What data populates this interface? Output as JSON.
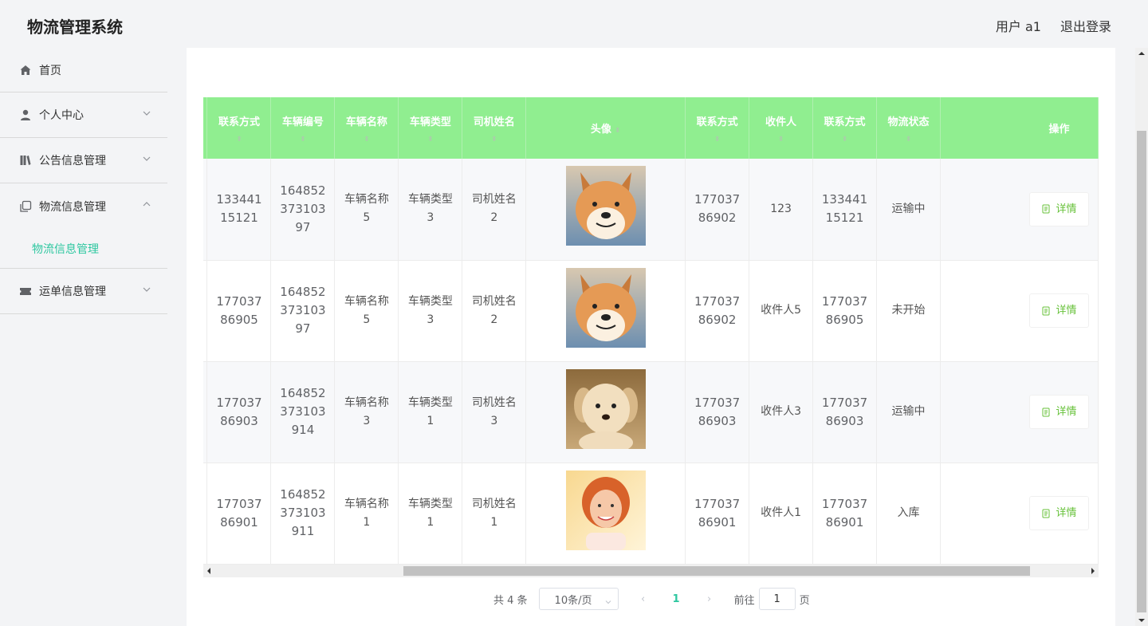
{
  "app_title": "物流管理系统",
  "header": {
    "user_label": "用户 a1",
    "logout_label": "退出登录"
  },
  "sidebar": {
    "items": [
      {
        "label": "首页",
        "icon": "home-icon"
      },
      {
        "label": "个人中心",
        "icon": "user-icon"
      },
      {
        "label": "公告信息管理",
        "icon": "notice-icon"
      },
      {
        "label": "物流信息管理",
        "icon": "copy-icon",
        "sub": "物流信息管理"
      },
      {
        "label": "运单信息管理",
        "icon": "ticket-icon"
      }
    ]
  },
  "table": {
    "columns": [
      "联系方式",
      "车辆编号",
      "车辆名称",
      "车辆类型",
      "司机姓名",
      "头像",
      "联系方式",
      "收件人",
      "联系方式",
      "物流状态",
      "操作"
    ],
    "rows": [
      {
        "phone1": "13344115121",
        "vehicle_no": "16485237310397",
        "vehicle_name": "车辆名称5",
        "vehicle_type": "车辆类型3",
        "driver": "司机姓名2",
        "avatar": "shiba-dog-photo",
        "phone2": "17703786902",
        "recipient": "123",
        "phone3": "13344115121",
        "status": "运输中",
        "action": "详情"
      },
      {
        "phone1": "17703786905",
        "vehicle_no": "16485237310397",
        "vehicle_name": "车辆名称5",
        "vehicle_type": "车辆类型3",
        "driver": "司机姓名2",
        "avatar": "shiba-dog-photo",
        "phone2": "17703786902",
        "recipient": "收件人5",
        "phone3": "17703786905",
        "status": "未开始",
        "action": "详情"
      },
      {
        "phone1": "17703786903",
        "vehicle_no": "164852373103914",
        "vehicle_name": "车辆名称3",
        "vehicle_type": "车辆类型1",
        "driver": "司机姓名3",
        "avatar": "puppy-photo",
        "phone2": "17703786903",
        "recipient": "收件人3",
        "phone3": "17703786903",
        "status": "运输中",
        "action": "详情"
      },
      {
        "phone1": "17703786901",
        "vehicle_no": "164852373103911",
        "vehicle_name": "车辆名称1",
        "vehicle_type": "车辆类型1",
        "driver": "司机姓名1",
        "avatar": "woman-photo",
        "phone2": "17703786901",
        "recipient": "收件人1",
        "phone3": "17703786901",
        "status": "入库",
        "action": "详情"
      }
    ]
  },
  "pagination": {
    "total": "共 4 条",
    "page_size": "10条/页",
    "current_page": "1",
    "goto_label": "前往",
    "goto_value": "1",
    "page_suffix": "页"
  },
  "colors": {
    "header_green": "#90ee90",
    "accent": "#2ec7a0",
    "detail_green": "#67c23a"
  }
}
